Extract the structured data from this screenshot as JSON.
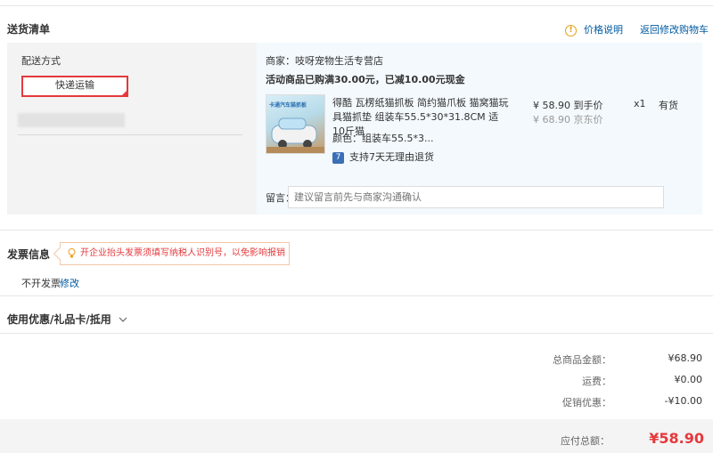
{
  "header": {
    "title": "送货清单",
    "price_info_label": "价格说明",
    "back_to_cart_label": "返回修改购物车"
  },
  "delivery": {
    "label": "配送方式",
    "selected_method": "快递运输"
  },
  "store": {
    "name_line": "商家：吱呀宠物生活专营店",
    "promo": "活动商品已购满30.00元，已减10.00元现金"
  },
  "product": {
    "image_caption": "卡通汽车猫抓板",
    "title": "得酷 瓦楞纸猫抓板 简约猫爪板 猫窝猫玩具猫抓垫 组装车55.5*30*31.8CM 适10斤猫",
    "price": "¥ 58.90 到手价",
    "jd_price": "¥ 68.90 京东价",
    "quantity": "x1",
    "stock": "有货",
    "color": "颜色：组装车55.5*3...",
    "return_policy": "支持7天无理由退货"
  },
  "message": {
    "label": "留言：",
    "placeholder": "建议留言前先与商家沟通确认"
  },
  "invoice": {
    "title": "发票信息",
    "tip": "开企业抬头发票须填写纳税人识别号，以免影响报销",
    "value": "不开发票",
    "edit_label": "修改"
  },
  "coupon": {
    "title": "使用优惠/礼品卡/抵用"
  },
  "summary": {
    "rows": [
      {
        "label": "总商品金额：",
        "value": "¥68.90"
      },
      {
        "label": "运费：",
        "value": "¥0.00"
      },
      {
        "label": "促销优惠：",
        "value": "-¥10.00"
      }
    ],
    "total_label": "应付总额：",
    "total_value": "¥58.90"
  },
  "colors": {
    "accent_red": "#e4393c",
    "link_blue": "#005aa0",
    "panel_blue": "#f3f9fd"
  }
}
